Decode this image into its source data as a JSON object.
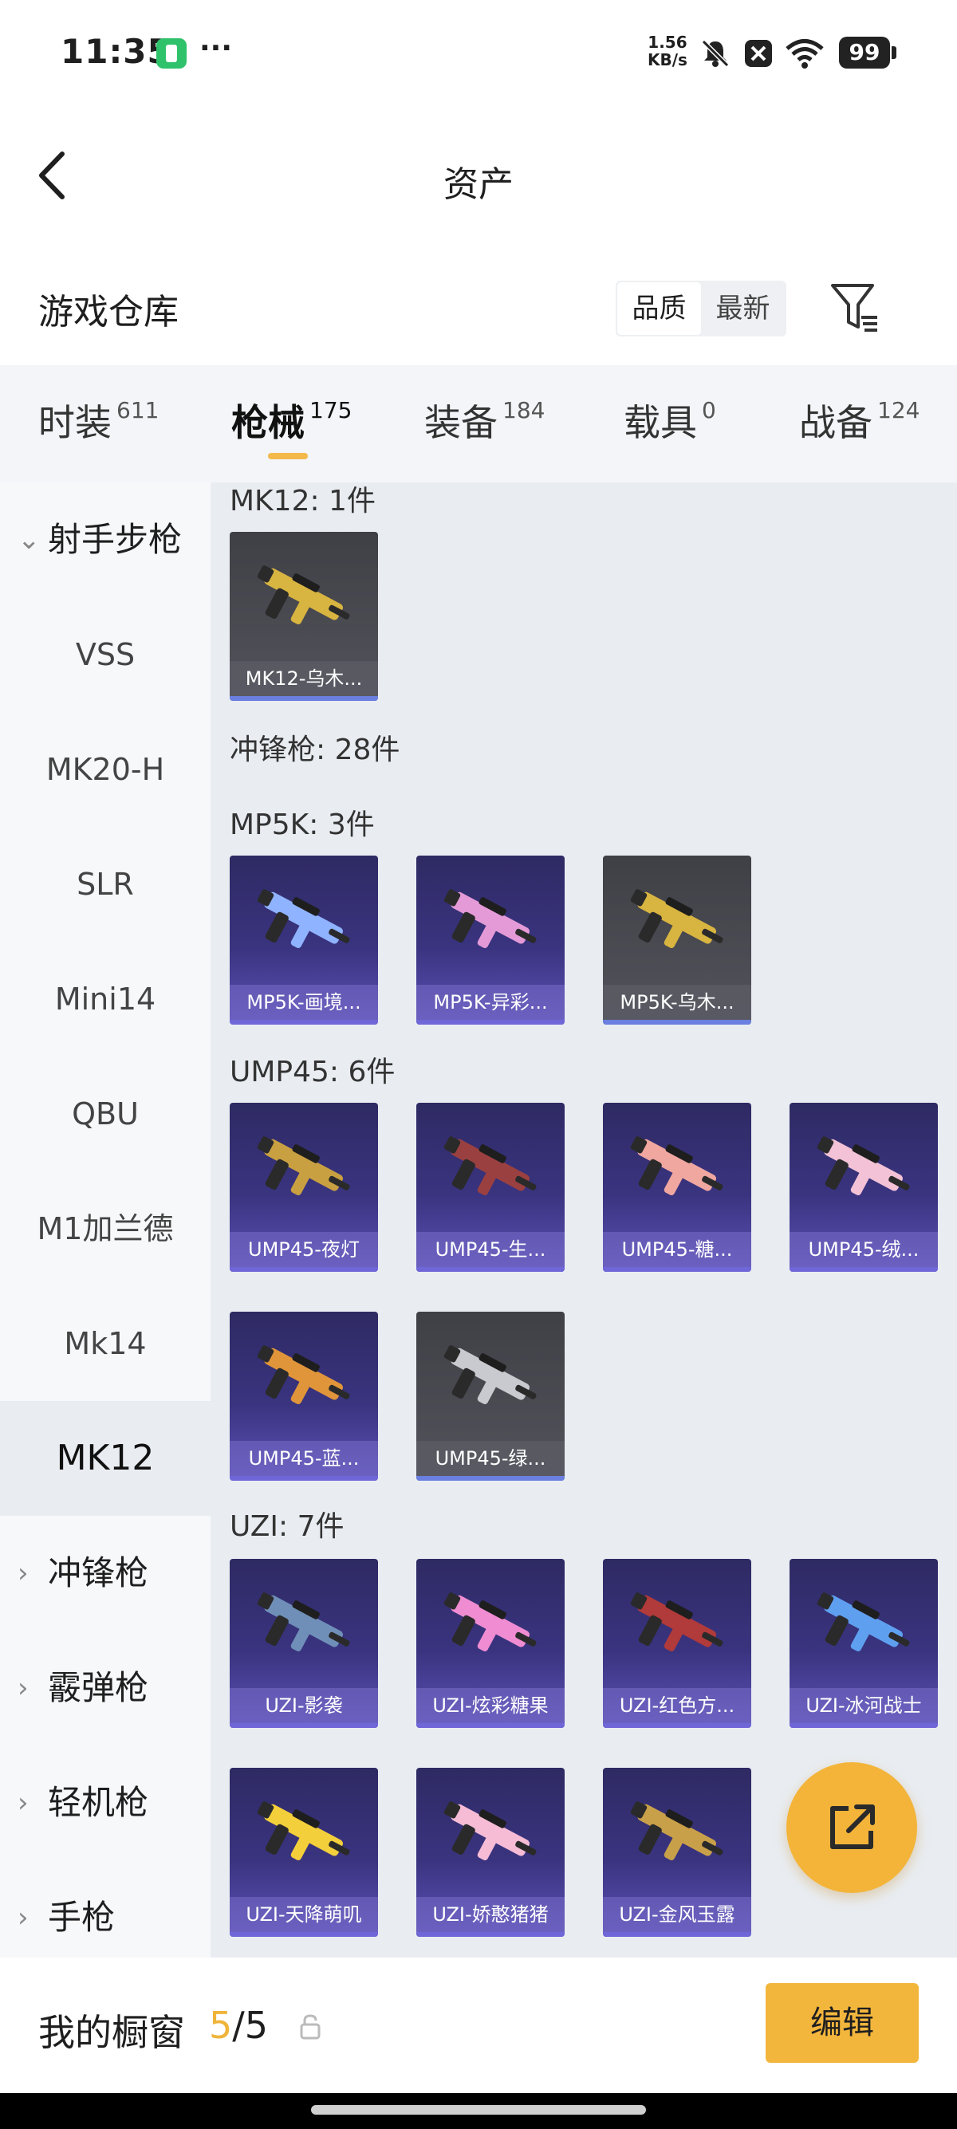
{
  "status_bar": {
    "time": "11:35",
    "more": "···",
    "net_speed_value": "1.56",
    "net_speed_unit": "KB/s",
    "battery": "99"
  },
  "header": {
    "title": "资产"
  },
  "warehouse": {
    "title": "游戏仓库",
    "sort_options": [
      "品质",
      "最新"
    ],
    "active_sort": "品质"
  },
  "tabs": [
    {
      "label": "时装",
      "count": "611"
    },
    {
      "label": "枪械",
      "count": "175",
      "active": true
    },
    {
      "label": "装备",
      "count": "184"
    },
    {
      "label": "载具",
      "count": "0"
    },
    {
      "label": "战备",
      "count": "124"
    }
  ],
  "sidebar": {
    "items": [
      {
        "label": "射手步枪",
        "type": "group",
        "expanded": true
      },
      {
        "label": "VSS"
      },
      {
        "label": "MK20-H"
      },
      {
        "label": "SLR"
      },
      {
        "label": "Mini14"
      },
      {
        "label": "QBU"
      },
      {
        "label": "M1加兰德"
      },
      {
        "label": "Mk14"
      },
      {
        "label": "MK12",
        "active": true
      },
      {
        "label": "冲锋枪",
        "type": "group"
      },
      {
        "label": "霰弹枪",
        "type": "group"
      },
      {
        "label": "轻机枪",
        "type": "group"
      },
      {
        "label": "手枪",
        "type": "group"
      }
    ]
  },
  "content": {
    "mk12_header": "MK12: 1件",
    "mk12_cards": [
      {
        "name": "MK12-乌木...",
        "color": "#d8b440",
        "style": "gray"
      }
    ],
    "smg_header": "冲锋枪: 28件",
    "mp5k_header": "MP5K: 3件",
    "mp5k_cards": [
      {
        "name": "MP5K-画境...",
        "color": "#8fb3ff"
      },
      {
        "name": "MP5K-异彩...",
        "color": "#e59ad8"
      },
      {
        "name": "MP5K-乌木...",
        "color": "#d8b440",
        "style": "gray"
      }
    ],
    "ump_header": "UMP45: 6件",
    "ump_cards": [
      {
        "name": "UMP45-夜灯",
        "color": "#c9a041"
      },
      {
        "name": "UMP45-生...",
        "color": "#9a4040"
      },
      {
        "name": "UMP45-糖...",
        "color": "#f0a7a0"
      },
      {
        "name": "UMP45-绒...",
        "color": "#f3c2d6"
      },
      {
        "name": "UMP45-蓝...",
        "color": "#e0953a"
      },
      {
        "name": "UMP45-绿...",
        "color": "#c9c9d0",
        "style": "gray"
      }
    ],
    "uzi_header": "UZI: 7件",
    "uzi_cards": [
      {
        "name": "UZI-影袭",
        "color": "#6f8fb8"
      },
      {
        "name": "UZI-炫彩糖果",
        "color": "#f08cd2"
      },
      {
        "name": "UZI-红色方...",
        "color": "#b13a3a"
      },
      {
        "name": "UZI-冰河战士",
        "color": "#5f9ff0"
      },
      {
        "name": "UZI-天降萌叽",
        "color": "#f3cf3b"
      },
      {
        "name": "UZI-娇憨猪猪",
        "color": "#f6bcd6"
      },
      {
        "name": "UZI-金风玉露",
        "color": "#c9a04a"
      }
    ]
  },
  "showcase": {
    "label": "我的橱窗",
    "current": "5",
    "separator": "/",
    "total": "5",
    "edit_label": "编辑"
  },
  "colors": {
    "accent": "#f3b63d",
    "content_bg": "#e9edf2",
    "card_purple": "#3a3480"
  }
}
